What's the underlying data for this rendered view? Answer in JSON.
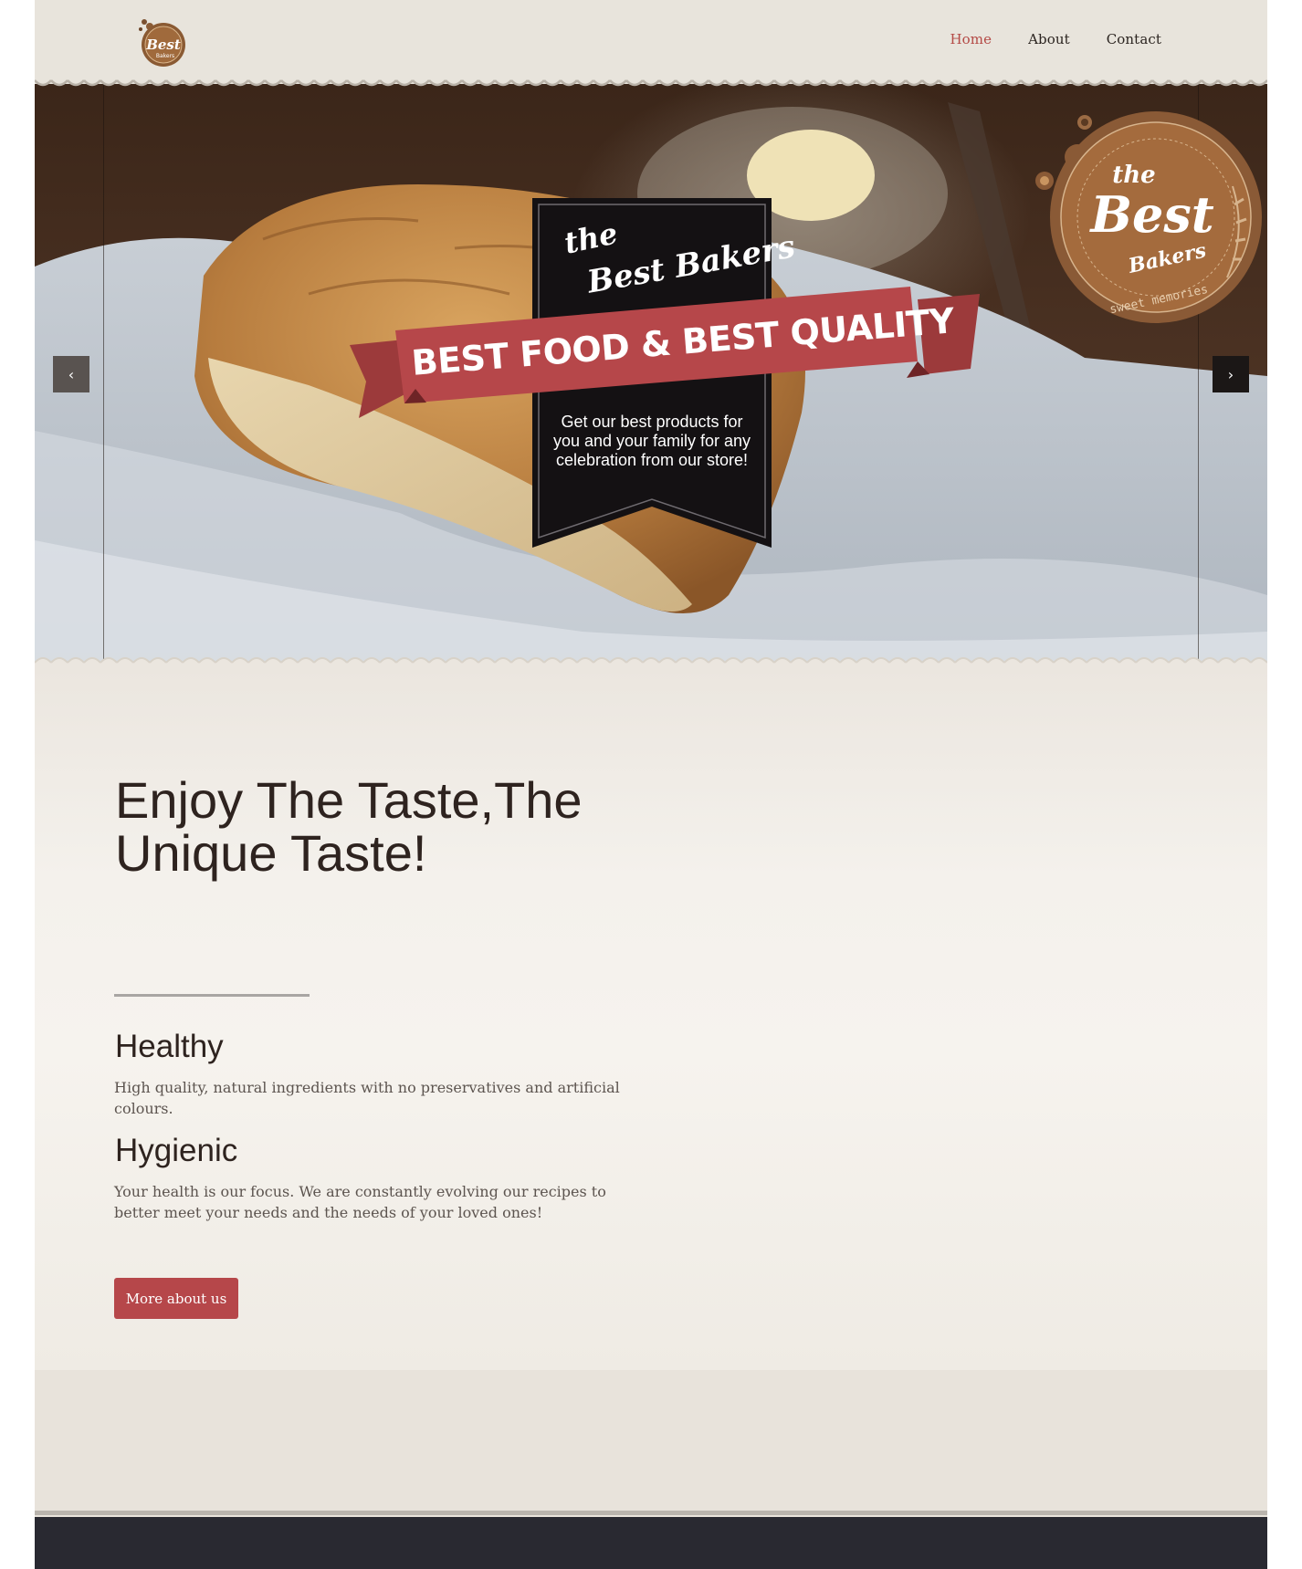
{
  "header": {
    "logo_alt": "the Best Bakers",
    "nav": [
      {
        "label": "Home",
        "active": true
      },
      {
        "label": "About",
        "active": false
      },
      {
        "label": "Contact",
        "active": false
      }
    ]
  },
  "hero": {
    "brand_the": "the",
    "brand_best": "Best Bakers",
    "ribbon": "BEST FOOD & BEST QUALITY",
    "description": "Get our best products for you and your family for any celebration from our store!",
    "badge": {
      "the": "the",
      "best": "Best",
      "bakers": "Bakers",
      "tagline": "sweet memories"
    },
    "prev_icon": "chevron-left-icon",
    "next_icon": "chevron-right-icon"
  },
  "about": {
    "headline": "Enjoy The Taste,The Unique Taste!",
    "features": [
      {
        "title": "Healthy",
        "text": "High quality, natural ingredients with no preservatives and artificial colours."
      },
      {
        "title": "Hygienic",
        "text": "Your health is our focus. We are constantly evolving our recipes to better meet your needs and the needs of your loved ones!"
      }
    ],
    "cta": "More about us"
  },
  "colors": {
    "accent": "#b6474a",
    "header_bg": "#e8e4dc",
    "footer_bg": "#292931",
    "text_dark": "#2e231f"
  }
}
